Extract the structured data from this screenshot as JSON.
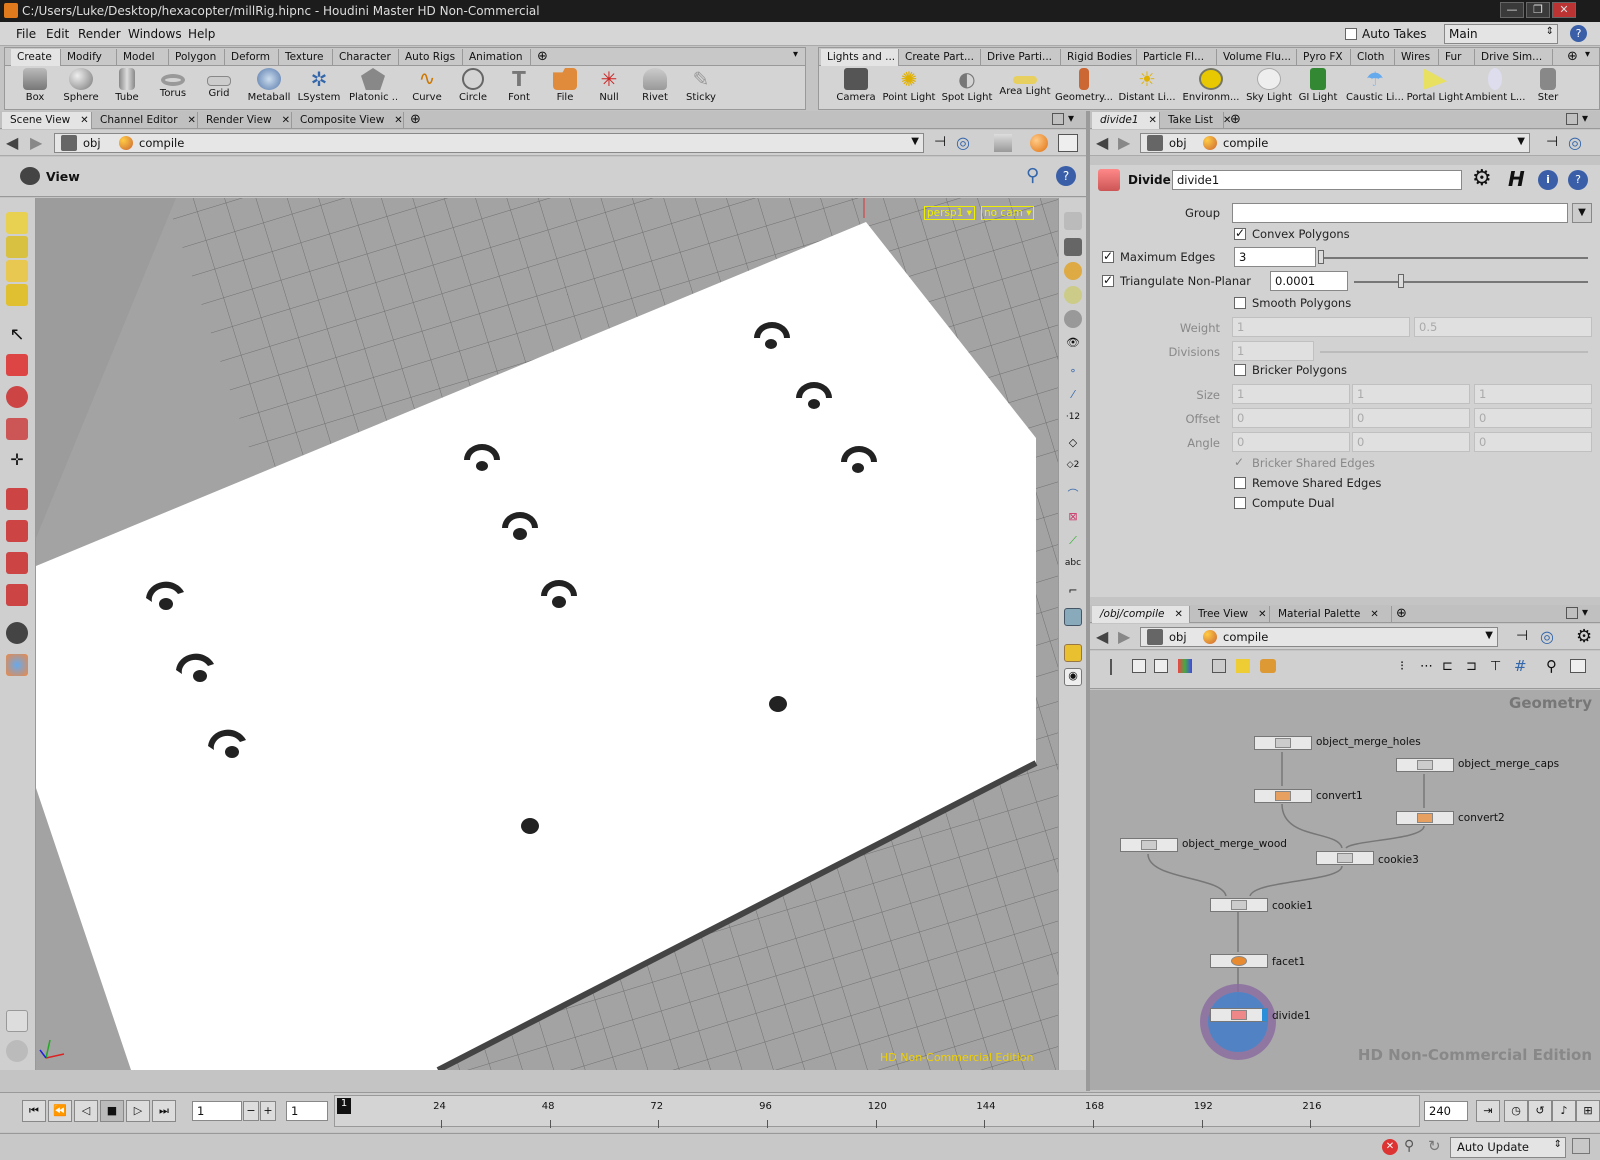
{
  "titlebar": {
    "title": "C:/Users/Luke/Desktop/hexacopter/millRig.hipnc - Houdini Master HD Non-Commercial",
    "min": "—",
    "max": "❐",
    "close": "✕"
  },
  "menubar": {
    "items": [
      "File",
      "Edit",
      "Render",
      "Windows",
      "Help"
    ],
    "auto_takes": "Auto Takes",
    "desktop": "Main"
  },
  "shelf_left": {
    "tabs": [
      "Create",
      "Modify",
      "Model",
      "Polygon",
      "Deform",
      "Texture",
      "Character",
      "Auto Rigs",
      "Animation"
    ],
    "tools": [
      "Box",
      "Sphere",
      "Tube",
      "Torus",
      "Grid",
      "Metaball",
      "LSystem",
      "Platonic ...",
      "Curve",
      "Circle",
      "Font",
      "File",
      "Null",
      "Rivet",
      "Sticky"
    ]
  },
  "shelf_right": {
    "tabs": [
      "Lights and ...",
      "Create Part...",
      "Drive Parti...",
      "Rigid Bodies",
      "Particle Fl...",
      "Volume Flu...",
      "Pyro FX",
      "Cloth",
      "Wires",
      "Fur",
      "Drive Sim..."
    ],
    "tools": [
      "Camera",
      "Point Light",
      "Spot Light",
      "Area Light",
      "Geometry...",
      "Distant Li...",
      "Environm...",
      "Sky Light",
      "GI Light",
      "Caustic Li...",
      "Portal Light",
      "Ambient L...",
      "Ster"
    ]
  },
  "scene_tabs": [
    "Scene View",
    "Channel Editor",
    "Render View",
    "Composite View"
  ],
  "scene_path": {
    "root": "obj",
    "node": "compile"
  },
  "viewer": {
    "label": "View",
    "camera": "persp1 ▾",
    "cam2": "no cam ▾",
    "watermark": "HD Non-Commercial Edition"
  },
  "param_tabs": [
    "divide1",
    "Take List"
  ],
  "param_path": {
    "root": "obj",
    "node": "compile"
  },
  "params": {
    "op_type": "Divide",
    "op_name": "divide1",
    "group_label": "Group",
    "convex": "Convex Polygons",
    "max_edges_label": "Maximum Edges",
    "max_edges": "3",
    "tri_label": "Triangulate Non-Planar",
    "tri_value": "0.0001",
    "smooth": "Smooth Polygons",
    "weight_label": "Weight",
    "weight_1": "1",
    "weight_2": "0.5",
    "divisions_label": "Divisions",
    "divisions": "1",
    "bricker": "Bricker Polygons",
    "size_label": "Size",
    "size": [
      "1",
      "1",
      "1"
    ],
    "offset_label": "Offset",
    "offset": [
      "0",
      "0",
      "0"
    ],
    "angle_label": "Angle",
    "angle": [
      "0",
      "0",
      "0"
    ],
    "bricker_shared": "Bricker Shared Edges",
    "remove_shared": "Remove Shared Edges",
    "compute_dual": "Compute Dual"
  },
  "net_tabs": [
    "/obj/compile",
    "Tree View",
    "Material Palette"
  ],
  "net_path": {
    "root": "obj",
    "node": "compile"
  },
  "network": {
    "context": "Geometry",
    "watermark": "HD Non-Commercial Edition",
    "nodes": {
      "omh": "object_merge_holes",
      "omc": "object_merge_caps",
      "conv1": "convert1",
      "conv2": "convert2",
      "omw": "object_merge_wood",
      "cookie3": "cookie3",
      "cookie1": "cookie1",
      "facet1": "facet1",
      "divide1": "divide1"
    }
  },
  "timeline": {
    "frame": "1",
    "start": "1",
    "end": "240",
    "current_marker": "1",
    "ticks": [
      "24",
      "48",
      "72",
      "96",
      "120",
      "144",
      "168",
      "192",
      "216"
    ]
  },
  "statusbar": {
    "auto_update": "Auto Update"
  },
  "colors": {
    "accent": "#e08b1c",
    "viewport_bg": "#9a9a9a",
    "grid_line": "#7a7a7a",
    "yellow_label": "#ffff00",
    "selection": "#2a8fd8"
  }
}
